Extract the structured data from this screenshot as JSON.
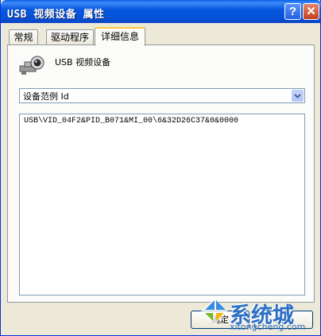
{
  "window": {
    "title": "USB 视频设备 属性"
  },
  "tabs": [
    {
      "label": "常规"
    },
    {
      "label": "驱动程序"
    },
    {
      "label": "详细信息",
      "active": true
    }
  ],
  "device": {
    "name": "USB 视频设备",
    "icon": "webcam-icon"
  },
  "property_select": {
    "value": "设备范例 Id"
  },
  "values_list": {
    "items": [
      "USB\\VID_04F2&PID_B071&MI_00\\6&32D26C37&0&0000"
    ]
  },
  "buttons": {
    "ok": "确定",
    "cancel": "取消"
  },
  "watermark": {
    "text": "系统城",
    "url": "xitongcheng.com"
  },
  "colors": {
    "titlebar": "#0858e0",
    "tab_highlight": "#ffc83c",
    "watermark": "#2c6fc6"
  }
}
